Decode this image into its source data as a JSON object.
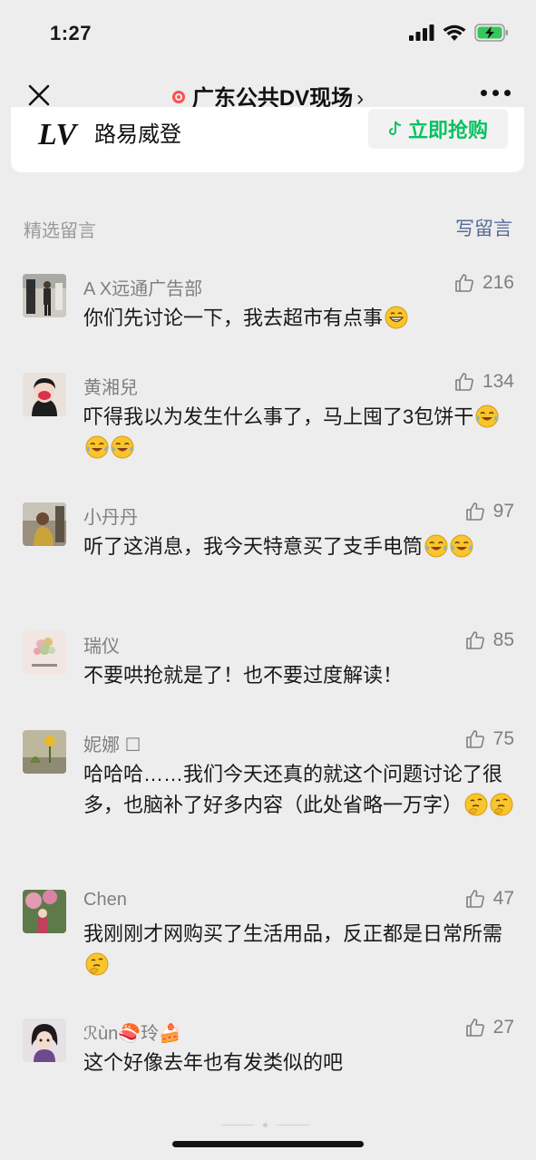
{
  "status": {
    "time": "1:27"
  },
  "nav": {
    "title": "广东公共DV现场",
    "chevron": "›"
  },
  "ad": {
    "logo": "LV",
    "brand": "路易威登",
    "button": "立即抢购"
  },
  "section": {
    "label": "精选留言",
    "write": "写留言"
  },
  "comments": [
    {
      "name": "A X远通广告部",
      "likes": "216",
      "text": "你们先讨论一下，我去超市有点事",
      "emoji": "grin"
    },
    {
      "name": "黄湘兒",
      "likes": "134",
      "text": "吓得我以为发生什么事了，马上囤了3包饼干",
      "emoji": "laugh-cry x3"
    },
    {
      "name": "小丹丹",
      "likes": "97",
      "text": "听了这消息，我今天特意买了支手电筒",
      "emoji": "laugh-cry x2"
    },
    {
      "name": "瑞仪",
      "likes": "85",
      "text": "不要哄抢就是了！也不要过度解读！",
      "emoji": ""
    },
    {
      "name": "妮娜 ☐",
      "likes": "75",
      "text": "哈哈哈……我们今天还真的就这个问题讨论了很多，也脑补了好多内容（此处省略一万字）",
      "emoji": "thinking x2"
    },
    {
      "name": "Chen",
      "likes": "47",
      "text": "我刚刚才网购买了生活用品，反正都是日常所需",
      "emoji": "thinking"
    },
    {
      "name": "ℛùn🍣玲🍰",
      "likes": "27",
      "text": "这个好像去年也有发类似的吧",
      "emoji": ""
    }
  ],
  "colors": {
    "background": "#ededed",
    "link": "#576b95",
    "green": "#07c160",
    "meta": "#7f7f7f"
  }
}
